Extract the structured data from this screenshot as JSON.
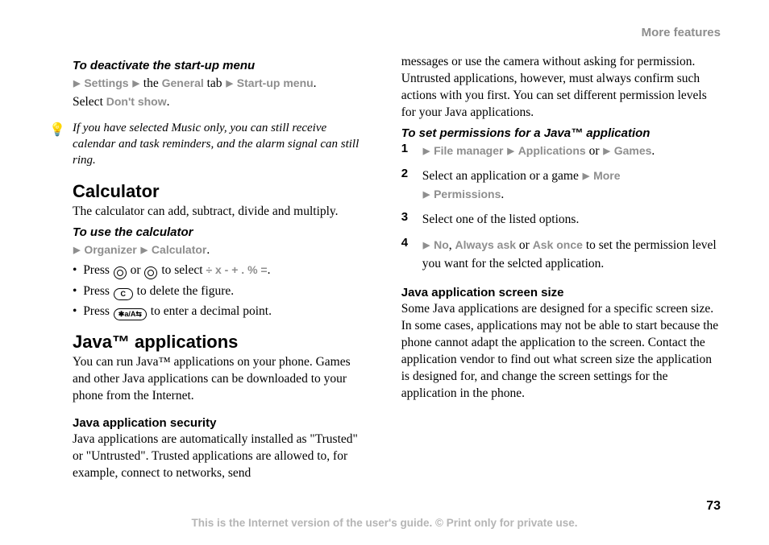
{
  "header": {
    "section": "More features"
  },
  "left": {
    "h_deactivate": "To deactivate the start-up menu",
    "deactivate_path": {
      "settings": "Settings",
      "general_pre": " the ",
      "general": "General",
      "general_post": " tab ",
      "startup": "Start-up menu"
    },
    "deactivate_select_pre": "Select ",
    "deactivate_select": "Don't show",
    "deactivate_select_post": ".",
    "tip": "If you have selected Music only, you can still receive calendar and task reminders, and the alarm signal can still ring.",
    "h_calculator": "Calculator",
    "calculator_body": "The calculator can add, subtract, divide and multiply.",
    "h_use_calculator": "To use the calculator",
    "calc_path": {
      "organizer": "Organizer",
      "calculator": "Calculator"
    },
    "calc_bullets": {
      "b1_pre": "Press ",
      "b1_mid": " or ",
      "b1_after": " to select ",
      "b1_ops": "÷ x - + . % =",
      "b2_pre": "Press ",
      "b2_key": "C",
      "b2_after": " to delete the figure.",
      "b3_pre": "Press ",
      "b3_key": "✱a/A⇆",
      "b3_after": " to enter a decimal point."
    },
    "h_java": "Java™ applications",
    "java_body": "You can run Java™ applications on your phone. Games and other Java applications can be downloaded to your phone from the Internet.",
    "h_java_security": "Java application security",
    "java_security_body": "Java applications are automatically installed as \"Trusted\" or \"Untrusted\". Trusted applications are allowed to, for example, connect to networks, send"
  },
  "right": {
    "cont_body": "messages or use the camera without asking for permission. Untrusted applications, however, must always confirm such actions with you first. You can set different permission levels for your Java applications.",
    "h_set_perm": "To set permissions for a Java™ application",
    "steps": {
      "s1": {
        "file_manager": "File manager",
        "applications": "Applications",
        "or": " or ",
        "games": "Games"
      },
      "s2_pre": "Select an application or a game ",
      "s2_more": "More",
      "s2_perm": "Permissions",
      "s3": "Select one of the listed options.",
      "s4_no": "No",
      "s4_sep1": ", ",
      "s4_always": "Always ask",
      "s4_sep2": " or ",
      "s4_once": "Ask once",
      "s4_after": " to set the permission level you want for the selcted application."
    },
    "h_screen_size": "Java application screen size",
    "screen_size_body": "Some Java applications are designed for a specific screen size. In some cases, applications may not be able to start because the phone cannot adapt the application to the screen. Contact the application vendor to find out what screen size the application is designed for, and change the screen settings for the application in the phone."
  },
  "footer": {
    "page": "73",
    "text": "This is the Internet version of the user's guide. © Print only for private use."
  }
}
